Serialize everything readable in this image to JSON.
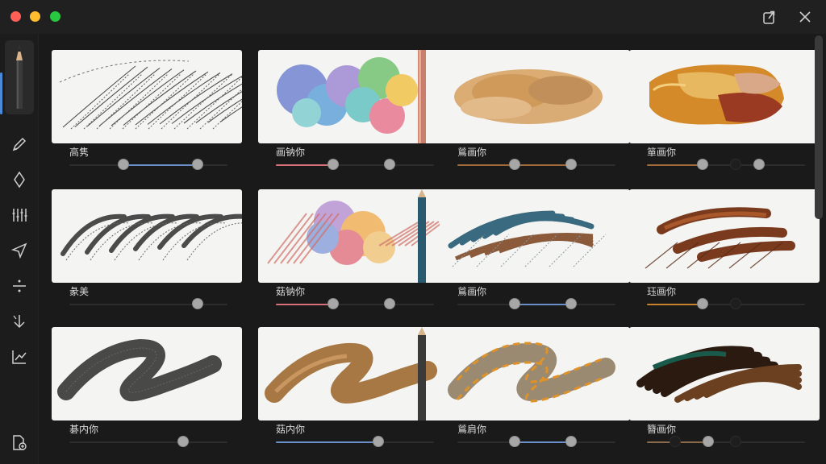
{
  "colors": {
    "accent_blue": "#6a8fc8",
    "accent_pink": "#d8707a",
    "accent_brown": "#a06a3a",
    "accent_orange": "#c8802a"
  },
  "titlebar": {
    "icons": [
      "share-icon",
      "close-icon"
    ]
  },
  "sidebar": {
    "items": [
      "pencil-brush-icon",
      "marker-icon",
      "pen-nib-icon",
      "brush-set-icon",
      "send-icon",
      "divide-icon",
      "arrow-down-icon",
      "chart-icon"
    ],
    "bottom": "export-file-icon"
  },
  "brushes": [
    {
      "label": "高隽",
      "style": "pencil-hatch",
      "slider": {
        "fill_color": "#6a8fc8",
        "from": 0.34,
        "to": 0.81,
        "thumbs": [
          0.34,
          0.81
        ],
        "dark_thumbs": []
      }
    },
    {
      "label": "画钠你",
      "style": "watercolor-rainbow",
      "slider": {
        "fill_color": "#d8707a",
        "from": 0,
        "to": 0.36,
        "thumbs": [
          0.36,
          0.72
        ],
        "dark_thumbs": []
      }
    },
    {
      "label": "鶑画你",
      "style": "watercolor-ochre",
      "slider": {
        "fill_color": "#a06a3a",
        "from": 0,
        "to": 0.72,
        "thumbs": [
          0.36,
          0.72
        ],
        "dark_thumbs": []
      }
    },
    {
      "label": "箪画你",
      "style": "oil-impasto",
      "slider": {
        "fill_color": "#a06a3a",
        "from": 0,
        "to": 0.35,
        "thumbs": [
          0.35,
          0.71
        ],
        "dark_thumbs": [
          0.56
        ]
      }
    },
    {
      "label": "彖美",
      "style": "charcoal-hatch",
      "slider": {
        "fill_color": "",
        "from": 0,
        "to": 0,
        "thumbs": [
          0.81
        ],
        "dark_thumbs": []
      }
    },
    {
      "label": "菇钠你",
      "style": "watercolor-pastel",
      "slider": {
        "fill_color": "#d8707a",
        "from": 0,
        "to": 0.36,
        "thumbs": [
          0.36,
          0.72
        ],
        "dark_thumbs": []
      }
    },
    {
      "label": "鶑画你",
      "style": "pastel-teal",
      "slider": {
        "fill_color": "#6a8fc8",
        "from": 0.36,
        "to": 0.72,
        "thumbs": [
          0.36,
          0.72
        ],
        "dark_thumbs": []
      }
    },
    {
      "label": "珏画你",
      "style": "oil-brown",
      "slider": {
        "fill_color": "#c8802a",
        "from": 0,
        "to": 0.35,
        "thumbs": [
          0.35
        ],
        "dark_thumbs": [
          0.56
        ]
      }
    },
    {
      "label": "碁内你",
      "style": "charcoal-wave",
      "slider": {
        "fill_color": "",
        "from": 0,
        "to": 0,
        "thumbs": [
          0.72
        ],
        "dark_thumbs": []
      }
    },
    {
      "label": "菇内你",
      "style": "gouache-wave",
      "slider": {
        "fill_color": "#6a8fc8",
        "from": 0,
        "to": 0.65,
        "thumbs": [
          0.65
        ],
        "dark_thumbs": []
      }
    },
    {
      "label": "鶑肩你",
      "style": "pastel-wave",
      "slider": {
        "fill_color": "#6a8fc8",
        "from": 0.36,
        "to": 0.72,
        "thumbs": [
          0.36,
          0.72
        ],
        "dark_thumbs": []
      }
    },
    {
      "label": "簪画你",
      "style": "oil-dark",
      "slider": {
        "fill_color": "#8a6a4a",
        "from": 0,
        "to": 0.39,
        "thumbs": [
          0.39
        ],
        "dark_thumbs": [
          0.56,
          0.18
        ]
      }
    }
  ]
}
